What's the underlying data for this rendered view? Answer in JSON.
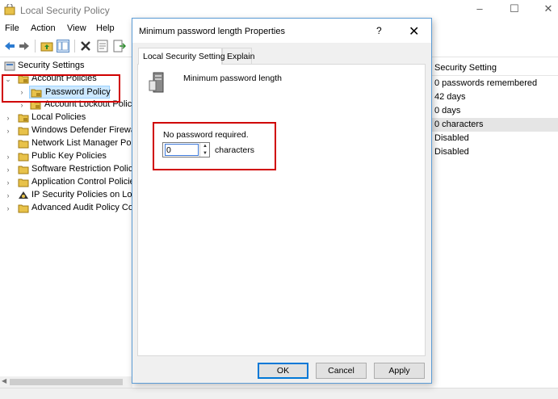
{
  "app": {
    "title": "Local Security Policy",
    "controls": [
      "–",
      "☐",
      "✕"
    ]
  },
  "menu": [
    "File",
    "Action",
    "View",
    "Help"
  ],
  "toolbar_icons": [
    "back-arrow-icon",
    "forward-arrow-icon",
    "folder-up-icon",
    "show-hide-tree-icon",
    "delete-icon",
    "properties-icon",
    "export-list-icon"
  ],
  "tree": {
    "root": "Security Settings",
    "items": [
      {
        "label": "Account Policies",
        "expanded": true
      },
      {
        "label": "Password Policy",
        "selected": true
      },
      {
        "label": "Account Lockout Polic"
      },
      {
        "label": "Local Policies"
      },
      {
        "label": "Windows Defender Firewa"
      },
      {
        "label": "Network List Manager Poli"
      },
      {
        "label": "Public Key Policies"
      },
      {
        "label": "Software Restriction Policie"
      },
      {
        "label": "Application Control Policie"
      },
      {
        "label": "IP Security Policies on Loca"
      },
      {
        "label": "Advanced Audit Policy Co"
      }
    ]
  },
  "right_list": {
    "header": "Security Setting",
    "rows": [
      "0 passwords remembered",
      "42 days",
      "0 days",
      "0 characters",
      "Disabled",
      "Disabled"
    ]
  },
  "dialog": {
    "title": "Minimum password length Properties",
    "help": "?",
    "close": "✕",
    "tabs": [
      "Local Security Setting",
      "Explain"
    ],
    "policy_name": "Minimum password length",
    "note": "No password required.",
    "value": "0",
    "units": "characters",
    "buttons": {
      "ok": "OK",
      "cancel": "Cancel",
      "apply": "Apply"
    }
  },
  "colors": {
    "highlight": "#d00000",
    "selection": "#cce8ff",
    "accent": "#0078d7"
  }
}
